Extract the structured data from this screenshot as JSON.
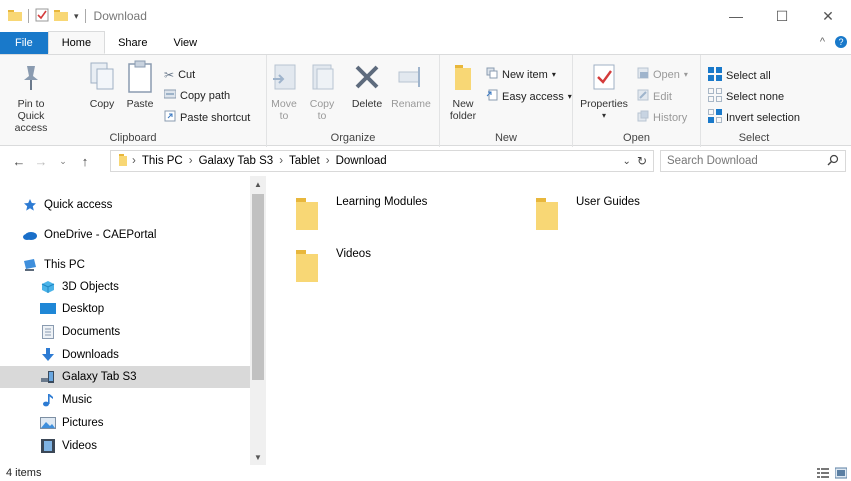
{
  "window": {
    "title": "Download",
    "minimize": "—",
    "maximize": "☐",
    "close": "✕"
  },
  "ribbon_tabs": [
    {
      "label": "File"
    },
    {
      "label": "Home"
    },
    {
      "label": "Share"
    },
    {
      "label": "View"
    }
  ],
  "ribbon": {
    "collapse": "^",
    "help": "?",
    "clipboard": {
      "label": "Clipboard",
      "pin": "Pin to Quick access",
      "copy": "Copy",
      "paste": "Paste",
      "cut": "Cut",
      "copy_path": "Copy path",
      "paste_shortcut": "Paste shortcut"
    },
    "organize": {
      "label": "Organize",
      "move_to": "Move to",
      "copy_to": "Copy to",
      "delete": "Delete",
      "rename": "Rename"
    },
    "new": {
      "label": "New",
      "new_folder": "New folder",
      "new_item": "New item",
      "easy_access": "Easy access"
    },
    "open": {
      "label": "Open",
      "properties": "Properties",
      "open": "Open",
      "edit": "Edit",
      "history": "History"
    },
    "select": {
      "label": "Select",
      "select_all": "Select all",
      "select_none": "Select none",
      "invert_selection": "Invert selection"
    }
  },
  "address": {
    "crumbs": [
      "This PC",
      "Galaxy Tab S3",
      "Tablet",
      "Download"
    ],
    "search_placeholder": "Search Download"
  },
  "nav": {
    "items": [
      {
        "label": "Quick access",
        "icon": "star-icon"
      },
      {
        "label": "OneDrive - CAEPortal",
        "icon": "cloud-icon"
      },
      {
        "label": "This PC",
        "icon": "computer-icon"
      },
      {
        "label": "3D Objects",
        "icon": "cube-icon"
      },
      {
        "label": "Desktop",
        "icon": "desktop-icon"
      },
      {
        "label": "Documents",
        "icon": "document-icon"
      },
      {
        "label": "Downloads",
        "icon": "download-arrow-icon"
      },
      {
        "label": "Galaxy Tab S3",
        "icon": "tablet-icon"
      },
      {
        "label": "Music",
        "icon": "music-note-icon"
      },
      {
        "label": "Pictures",
        "icon": "picture-icon"
      },
      {
        "label": "Videos",
        "icon": "film-icon"
      }
    ]
  },
  "content": {
    "folders": [
      {
        "name": "Learning Modules"
      },
      {
        "name": "User Guides"
      },
      {
        "name": "Videos"
      }
    ]
  },
  "status": {
    "count": "4 items"
  },
  "colors": {
    "accent": "#1979ca",
    "folder": "#f8d775",
    "folder_dark": "#e8b73c"
  }
}
